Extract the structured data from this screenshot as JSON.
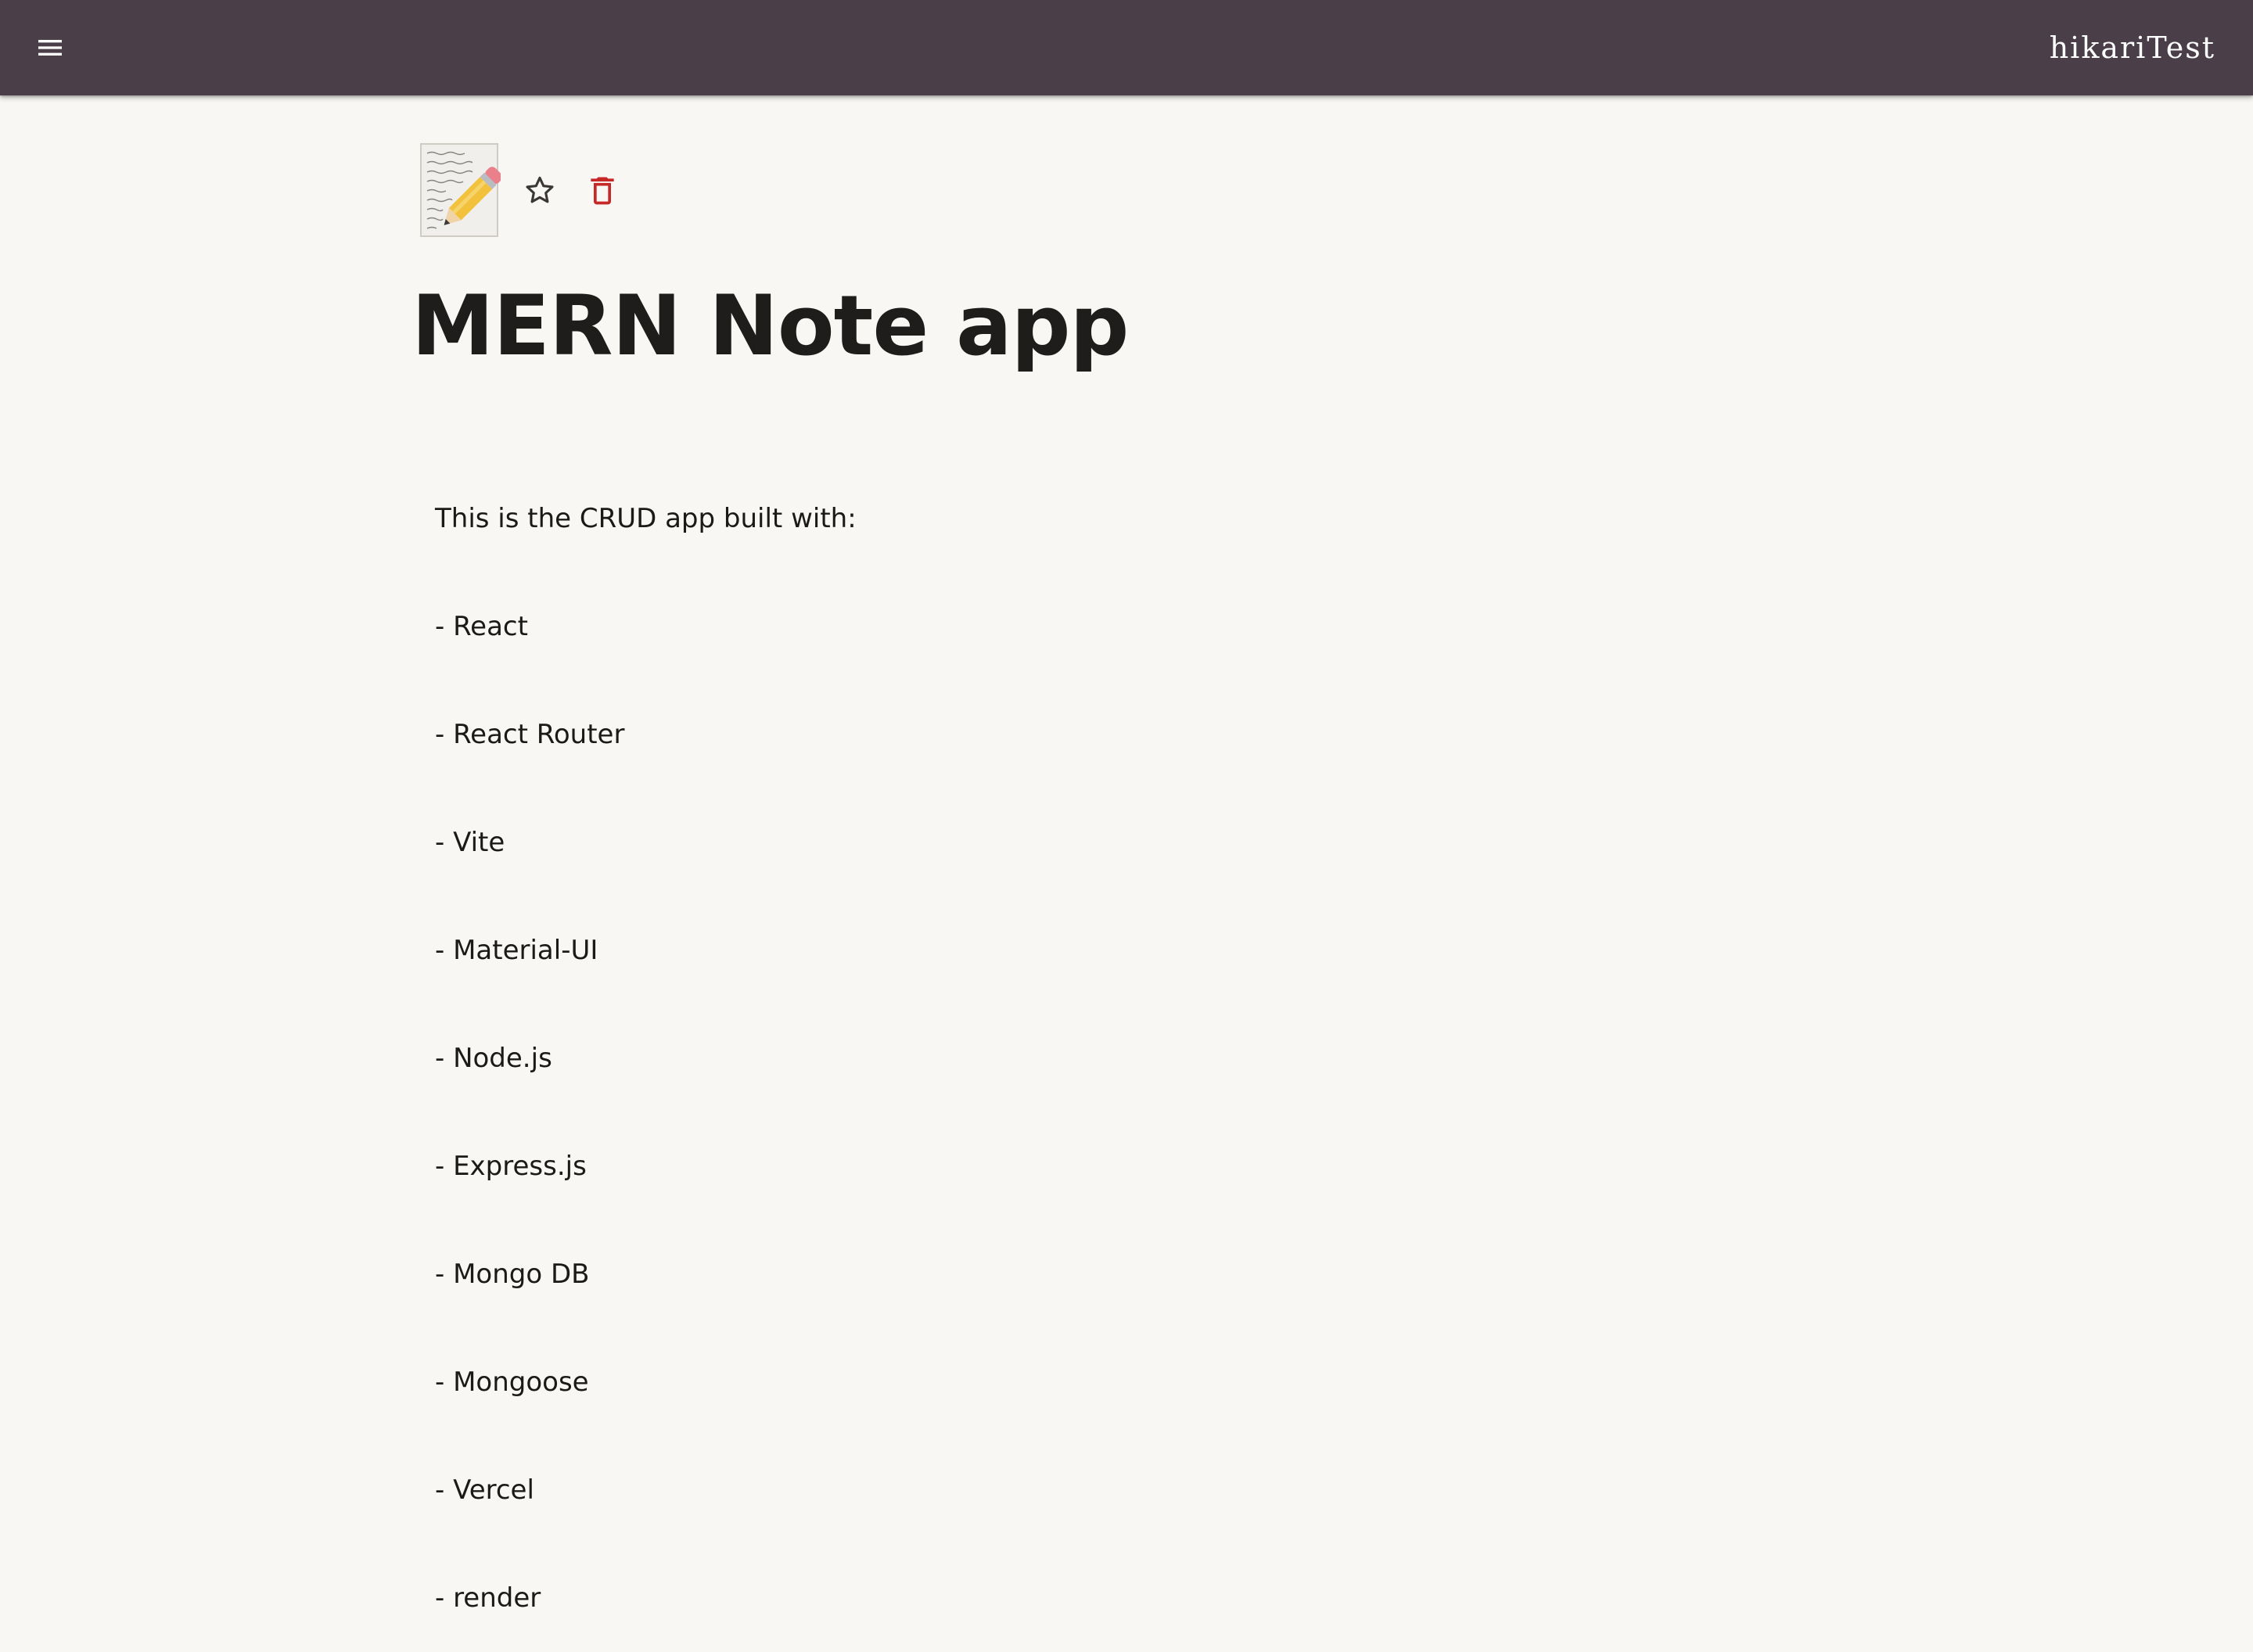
{
  "appbar": {
    "title": "hikariTest",
    "menu_icon": "menu-icon",
    "background": "#4a3f49"
  },
  "note": {
    "thumbnail_icon": "memo-emoji-icon",
    "favorite_icon": "star-outline-icon",
    "delete_icon": "trash-icon",
    "delete_color": "#c62828",
    "title": "MERN Note app",
    "body_lines": [
      "This is the CRUD app built with:",
      "- React",
      "- React Router",
      "- Vite",
      "- Material-UI",
      "- Node.js",
      "- Express.js",
      "- Mongo DB",
      "- Mongoose",
      "- Vercel",
      "- render"
    ]
  }
}
